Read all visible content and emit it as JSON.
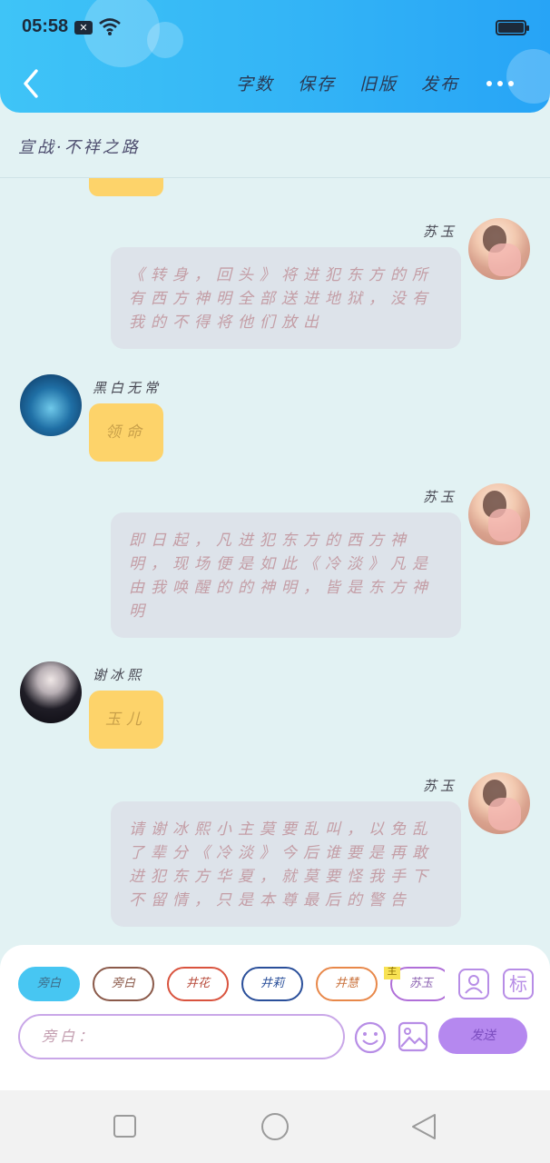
{
  "status": {
    "time": "05:58",
    "notif_icon": "close-box-icon"
  },
  "header": {
    "back_icon": "chevron-left-icon",
    "actions": [
      "字数",
      "保存",
      "旧版",
      "发布"
    ],
    "more_icon": "more-dots-icon"
  },
  "title": "宣战·不祥之路",
  "messages": [
    {
      "side": "right",
      "name": "苏玉",
      "text": "《转身，回头》将进犯东方的所有西方神明全部送进地狱，没有我的不得将他们放出"
    },
    {
      "side": "left",
      "name": "黑白无常",
      "text": "领命"
    },
    {
      "side": "right",
      "name": "苏玉",
      "text": "即日起，凡进犯东方的西方神明，现场便是如此《冷淡》凡是由我唤醒的的神明，皆是东方神明"
    },
    {
      "side": "left",
      "name": "谢冰熙",
      "text": "玉儿"
    },
    {
      "side": "right",
      "name": "苏玉",
      "text": "请谢冰熙小主莫要乱叫，以免乱了辈分《冷淡》今后谁要是再敢进犯东方华夏，就莫要怪我手下不留情，只是本尊最后的警告"
    }
  ],
  "composer": {
    "chips": [
      "旁白",
      "旁白",
      "井花",
      "井莉",
      "井慧",
      "苏玉"
    ],
    "chip_colors": [
      "#47c6f2",
      "#8b5a4a",
      "#d9533e",
      "#2a4f9a",
      "#e8884a",
      "#b06fd8"
    ],
    "chip_tag": "主",
    "contact_icon": "contact-card-icon",
    "tag_button": "标",
    "input_placeholder": "旁白：",
    "emoji_icon": "smiley-icon",
    "image_icon": "image-icon",
    "send_label": "发送"
  },
  "nav": {
    "square_icon": "recent-apps-icon",
    "circle_icon": "home-icon",
    "triangle_icon": "back-triangle-icon"
  }
}
